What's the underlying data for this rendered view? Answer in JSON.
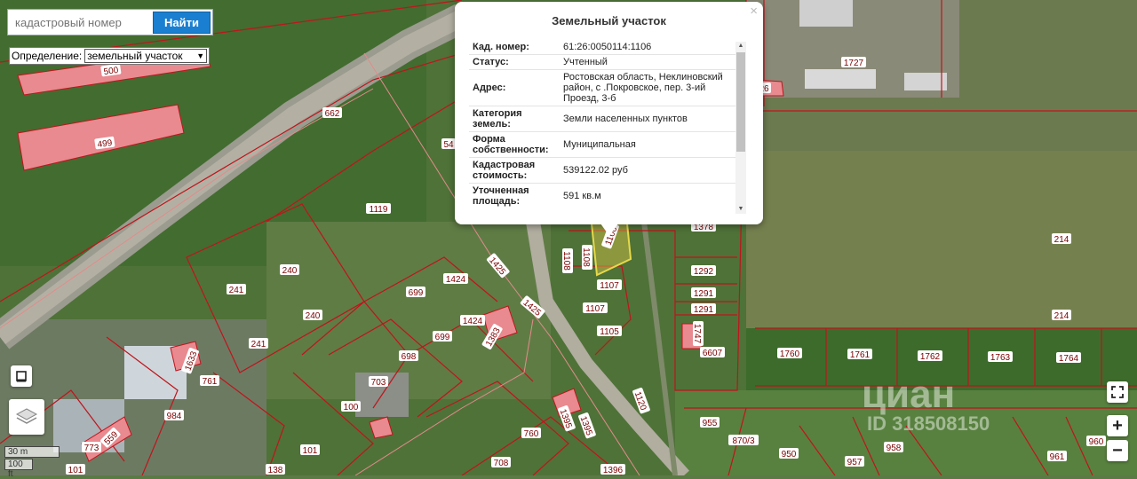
{
  "search": {
    "placeholder": "кадастровый номер",
    "button_label": "Найти"
  },
  "definition": {
    "label": "Определение:",
    "selected": "земельный участок"
  },
  "popup": {
    "title": "Земельный участок",
    "close": "×",
    "rows": [
      {
        "key": "Кад. номер:",
        "value": "61:26:0050114:1106"
      },
      {
        "key": "Статус:",
        "value": "Учтенный"
      },
      {
        "key": "Адрес:",
        "value": "Ростовская область, Неклиновский район, с .Покровское, пер. 3-ий Проезд, 3-б"
      },
      {
        "key": "Категория земель:",
        "value": "Земли населенных пунктов"
      },
      {
        "key": "Форма собственности:",
        "value": "Муниципальная"
      },
      {
        "key": "Кадастровая стоимость:",
        "value": "539122.02 руб"
      },
      {
        "key": "Уточненная площадь:",
        "value": "591 кв.м"
      }
    ]
  },
  "map_labels": [
    "500",
    "499",
    "662",
    "54",
    "1119",
    "240",
    "241",
    "240",
    "241",
    "699",
    "1424",
    "1425",
    "1424",
    "699",
    "1383",
    "698",
    "703",
    "100",
    "761",
    "984",
    "559",
    "773",
    "101",
    "1108",
    "1108",
    "1107",
    "1107",
    "1105",
    "1425",
    "1120",
    "1395",
    "1395",
    "760",
    "708",
    "1396",
    "1106",
    "1727",
    "26",
    "1378",
    "1292",
    "1291",
    "1291",
    "6607",
    "1747",
    "214",
    "214",
    "1760",
    "1761",
    "1762",
    "1763",
    "1764",
    "955",
    "870/3",
    "950",
    "957",
    "958",
    "961",
    "960",
    "1633",
    "101",
    "138"
  ],
  "scale": {
    "metric": "30 m",
    "imperial": "100 ft"
  },
  "zoom": {
    "in": "+",
    "out": "−"
  },
  "watermark": {
    "brand": "циан",
    "id": "ID 318508150"
  },
  "colors": {
    "accent": "#1a7fd1",
    "parcel_line": "#c0141c",
    "selected_parcel": "#e6d94a",
    "building_fill": "#e88a8f"
  }
}
